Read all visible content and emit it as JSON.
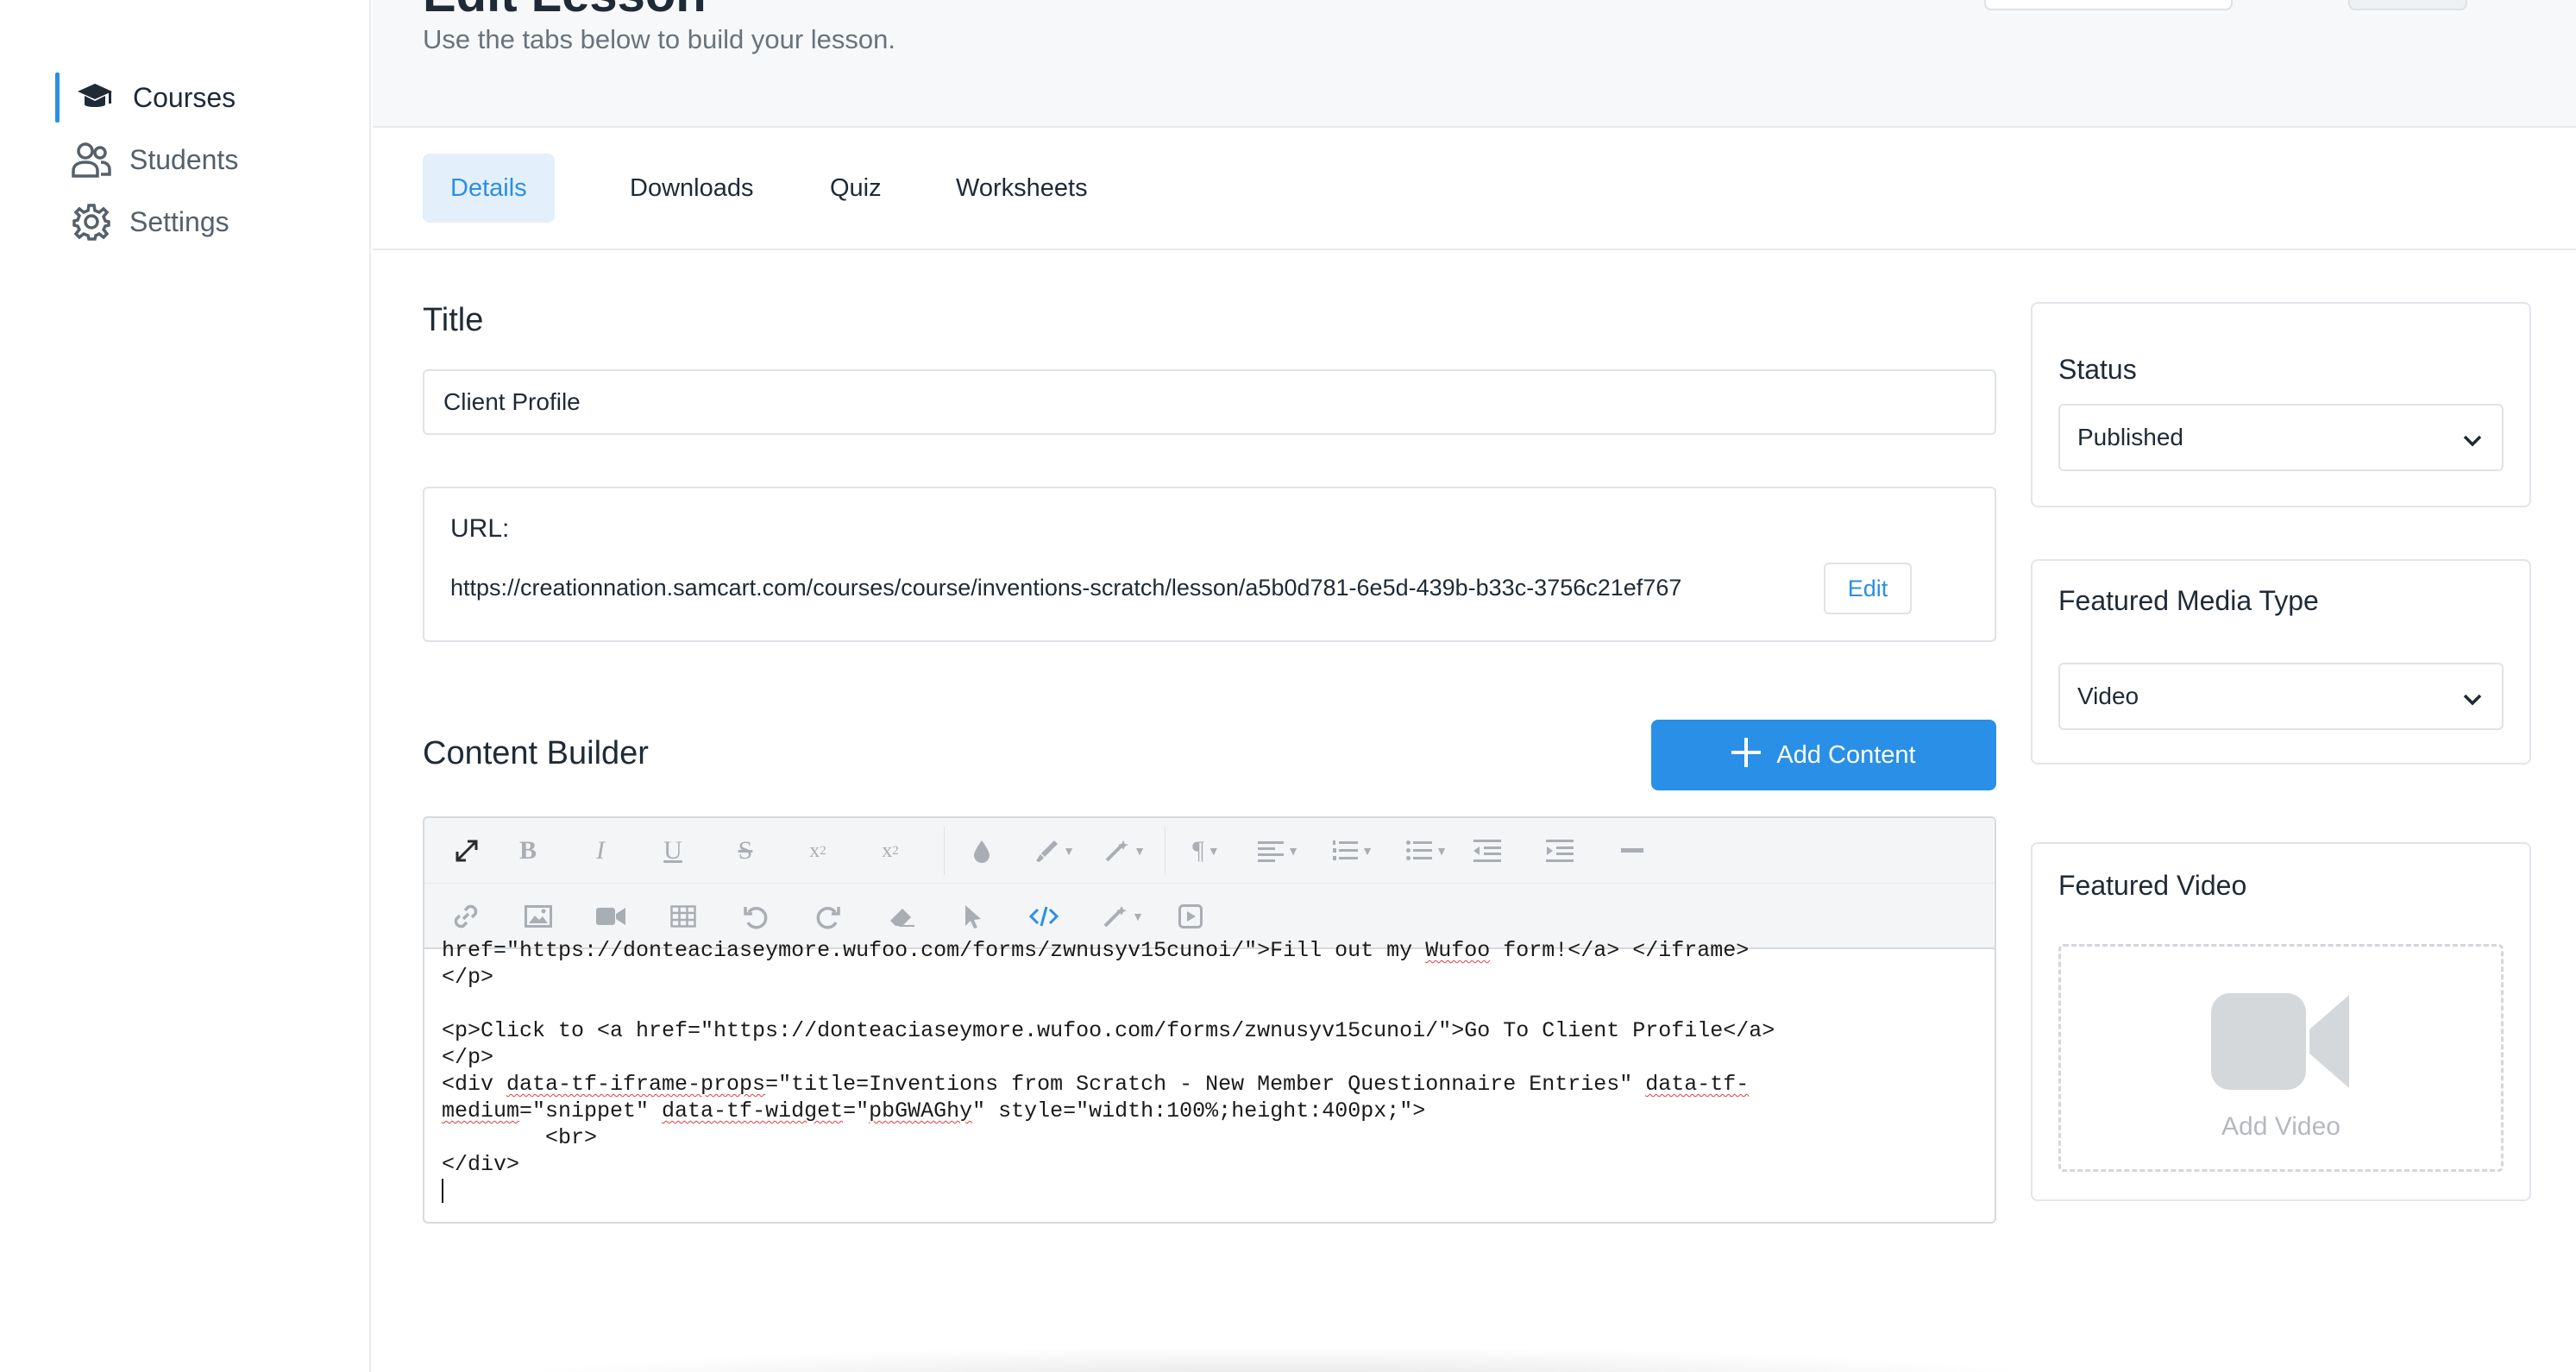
{
  "sidebar": {
    "items": [
      {
        "label": "Courses",
        "icon": "graduation-cap-icon",
        "active": true
      },
      {
        "label": "Students",
        "icon": "users-icon",
        "active": false
      },
      {
        "label": "Settings",
        "icon": "gear-icon",
        "active": false
      }
    ]
  },
  "header": {
    "title": "Edit Lesson",
    "subtitle": "Use the tabs below to build your lesson."
  },
  "tabs": [
    {
      "label": "Details",
      "active": true
    },
    {
      "label": "Downloads",
      "active": false
    },
    {
      "label": "Quiz",
      "active": false
    },
    {
      "label": "Worksheets",
      "active": false
    }
  ],
  "form": {
    "title_label": "Title",
    "title_value": "Client Profile",
    "url_label": "URL:",
    "url_value": "https://creationnation.samcart.com/courses/course/inventions-scratch/lesson/a5b0d781-6e5d-439b-b33c-3756c21ef767",
    "url_edit_label": "Edit",
    "content_builder_label": "Content Builder",
    "add_content_label": "Add Content"
  },
  "editor": {
    "code": {
      "l1a": "href=\"https://donteaciaseymore.wufoo.com/forms/zwnusyv15cunoi/\">Fill out my ",
      "l1b": "Wufoo",
      "l1c": " form!</a> </iframe>",
      "l2": "</p>",
      "l3": "",
      "l4": "<p>Click to <a href=\"https://donteaciaseymore.wufoo.com/forms/zwnusyv15cunoi/\">Go To Client Profile</a>",
      "l5": "</p>",
      "l6a": "<div ",
      "l6b": "data-tf-iframe-props",
      "l6c": "=\"title=Inventions from Scratch - New Member Questionnaire Entries\" ",
      "l6d": "data-tf-",
      "l7a": "medium",
      "l7b": "=\"snippet\" ",
      "l7c": "data-tf-widget",
      "l7d": "=\"",
      "l7e": "pbGWAGhy",
      "l7f": "\" style=\"width:100%;height:400px;\">",
      "l8": "        <br>",
      "l9": "</div>"
    }
  },
  "status_panel": {
    "title": "Status",
    "value": "Published"
  },
  "media_panel": {
    "title": "Featured Media Type",
    "value": "Video"
  },
  "video_panel": {
    "title": "Featured Video",
    "placeholder": "Add Video"
  },
  "colors": {
    "accent": "#2a8fe6",
    "tab_active_bg": "#e3f0fb"
  }
}
